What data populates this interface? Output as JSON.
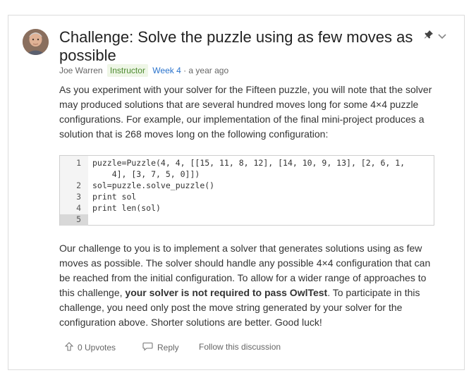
{
  "post": {
    "title": "Challenge: Solve the puzzle using as few moves as possible",
    "author": "Joe Warren",
    "role_badge": "Instructor",
    "week": "Week 4",
    "time_separator": " · ",
    "time": "a year ago",
    "paragraph1": "As you experiment with your solver for the Fifteen puzzle, you will note that the solver may produced solutions that are several hundred moves long for some 4×4 puzzle configurations. For example, our implementation of the final mini-project produces a solution that is 268 moves long on the following configuration:",
    "code": {
      "line_numbers": [
        "1",
        "2",
        "3",
        "4",
        "5"
      ],
      "lines": [
        "puzzle=Puzzle(4, 4, [[15, 11, 8, 12], [14, 10, 9, 13], [2, 6, 1,",
        "    4], [3, 7, 5, 0]])",
        "sol=puzzle.solve_puzzle()",
        "print sol",
        "print len(sol)",
        ""
      ]
    },
    "paragraph2_before": "Our challenge to you is to implement a solver that generates solutions using as few moves as possible. The solver should handle any possible 4×4 configuration that can be reached from the initial configuration. To allow for a wider range of approaches to this challenge, ",
    "paragraph2_bold": "your solver is not required to pass OwlTest",
    "paragraph2_after": ". To participate in this challenge, you need only post the move string generated by your solver for the configuration above. Shorter solutions are better. Good luck!"
  },
  "footer": {
    "upvotes_label": "0 Upvotes",
    "reply_label": "Reply",
    "follow_label": "Follow this discussion"
  },
  "icons": {
    "pin": "pin-icon",
    "chevron": "chevron-down-icon",
    "upvote": "arrow-up-icon",
    "reply": "speech-bubble-icon"
  }
}
